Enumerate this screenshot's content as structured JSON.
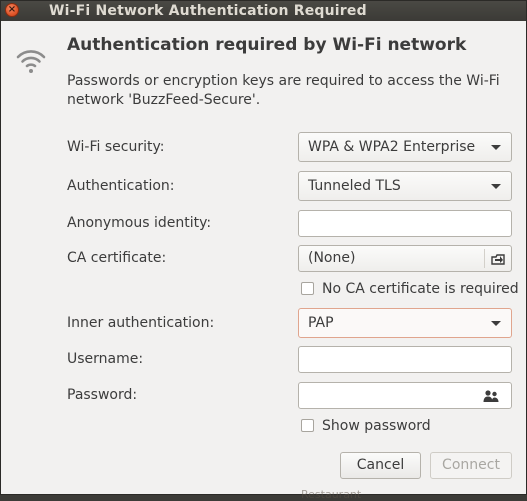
{
  "window": {
    "title": "Wi-Fi Network Authentication Required",
    "close_glyph": "×"
  },
  "dialog": {
    "heading": "Authentication required by Wi-Fi network",
    "description": "Passwords or encryption keys are required to access the Wi-Fi network 'BuzzFeed-Secure'."
  },
  "form": {
    "wifi_security": {
      "label": "Wi-Fi security:",
      "value": "WPA & WPA2 Enterprise"
    },
    "authentication": {
      "label": "Authentication:",
      "value": "Tunneled TLS"
    },
    "anonymous_identity": {
      "label": "Anonymous identity:",
      "value": ""
    },
    "ca_certificate": {
      "label": "CA certificate:",
      "value": "(None)"
    },
    "no_ca_certificate": {
      "label": "No CA certificate is required",
      "checked": false
    },
    "inner_authentication": {
      "label": "Inner authentication:",
      "value": "PAP"
    },
    "username": {
      "label": "Username:",
      "value": ""
    },
    "password": {
      "label": "Password:",
      "value": ""
    },
    "show_password": {
      "label": "Show password",
      "checked": false
    }
  },
  "buttons": {
    "cancel": "Cancel",
    "connect": "Connect"
  },
  "icons": {
    "wifi": "wifi-signal-icon",
    "file_chooser": "file-open-icon",
    "password_users": "users-icon"
  },
  "colors": {
    "close_button": "#e1562a",
    "titlebar": "#3b3a36",
    "dialog_bg": "#f2f1f0",
    "focus_border": "#e0a58e"
  },
  "background_peek": "Restaurant"
}
